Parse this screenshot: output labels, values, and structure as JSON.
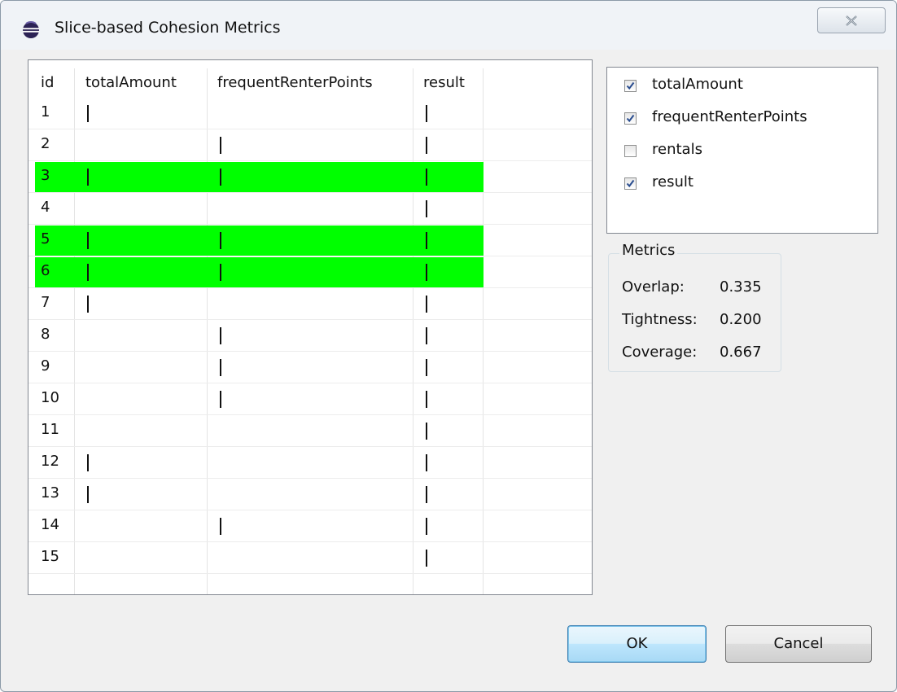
{
  "dialog": {
    "title": "Slice-based Cohesion Metrics",
    "icon": "eclipse-icon",
    "close_icon": "close-icon"
  },
  "table": {
    "columns": [
      "id",
      "totalAmount",
      "frequentRenterPoints",
      "result"
    ],
    "rows": [
      {
        "id": "1",
        "marks": [
          true,
          false,
          true
        ],
        "highlighted": false
      },
      {
        "id": "2",
        "marks": [
          false,
          true,
          true
        ],
        "highlighted": false
      },
      {
        "id": "3",
        "marks": [
          true,
          true,
          true
        ],
        "highlighted": true
      },
      {
        "id": "4",
        "marks": [
          false,
          false,
          true
        ],
        "highlighted": false
      },
      {
        "id": "5",
        "marks": [
          true,
          true,
          true
        ],
        "highlighted": true
      },
      {
        "id": "6",
        "marks": [
          true,
          true,
          true
        ],
        "highlighted": true
      },
      {
        "id": "7",
        "marks": [
          true,
          false,
          true
        ],
        "highlighted": false
      },
      {
        "id": "8",
        "marks": [
          false,
          true,
          true
        ],
        "highlighted": false
      },
      {
        "id": "9",
        "marks": [
          false,
          true,
          true
        ],
        "highlighted": false
      },
      {
        "id": "10",
        "marks": [
          false,
          true,
          true
        ],
        "highlighted": false
      },
      {
        "id": "11",
        "marks": [
          false,
          false,
          true
        ],
        "highlighted": false
      },
      {
        "id": "12",
        "marks": [
          true,
          false,
          true
        ],
        "highlighted": false
      },
      {
        "id": "13",
        "marks": [
          true,
          false,
          true
        ],
        "highlighted": false
      },
      {
        "id": "14",
        "marks": [
          false,
          true,
          true
        ],
        "highlighted": false
      },
      {
        "id": "15",
        "marks": [
          false,
          false,
          true
        ],
        "highlighted": false
      }
    ],
    "highlight_color": "#00ff00"
  },
  "variables": [
    {
      "label": "totalAmount",
      "checked": true
    },
    {
      "label": "frequentRenterPoints",
      "checked": true
    },
    {
      "label": "rentals",
      "checked": false
    },
    {
      "label": "result",
      "checked": true
    }
  ],
  "metrics": {
    "title": "Metrics",
    "items": [
      {
        "label": "Overlap:",
        "value": "0.335"
      },
      {
        "label": "Tightness:",
        "value": "0.200"
      },
      {
        "label": "Coverage:",
        "value": "0.667"
      }
    ]
  },
  "buttons": {
    "ok_label": "OK",
    "cancel_label": "Cancel"
  }
}
